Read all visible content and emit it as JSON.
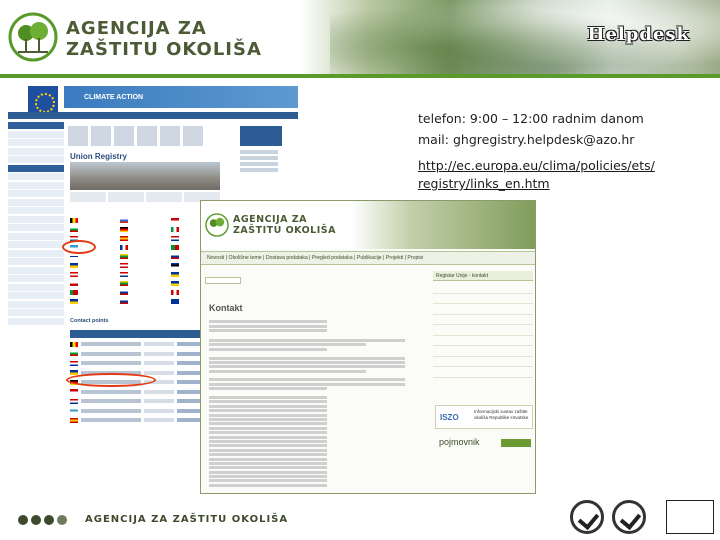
{
  "header": {
    "logo_line1": "AGENCIJA ZA",
    "logo_line2": "ZAŠTITU OKOLIŠA",
    "title": "Helpdesk"
  },
  "info": {
    "phone": "telefon: 9:00 – 12:00 radnim danom",
    "mail": "mail: ghgregistry.helpdesk@azo.hr",
    "link": "http://ec.europa.eu/clima/policies/ets/registry/links_en.htm"
  },
  "screenshot1": {
    "banner": "CLIMATE ACTION",
    "title": "Union Registry",
    "contact_heading": "Contact points"
  },
  "screenshot2": {
    "logo_line1": "AGENCIJA ZA",
    "logo_line2": "ZAŠTITU OKOLIŠA",
    "nav": "Novosti | Okolišne teme | Dostava podataka | Pregled podataka | Publikacije | Projekti | Propisi",
    "page_title": "Kontakt",
    "panel_title": "Registar Unije - kontakt",
    "isz_label": "ISZO",
    "isz_text": "Informacijski sustav zaštite okoliša Republike Hrvatske",
    "pojmovnik": "pojmovnik"
  },
  "footer": {
    "text": "AGENCIJA ZA ZAŠTITU OKOLIŠA"
  },
  "colors": {
    "brand_dark": "#3f4a2c",
    "brand_green": "#5a9a2a",
    "highlight": "#e23b14",
    "eu_blue": "#2d5b94"
  }
}
